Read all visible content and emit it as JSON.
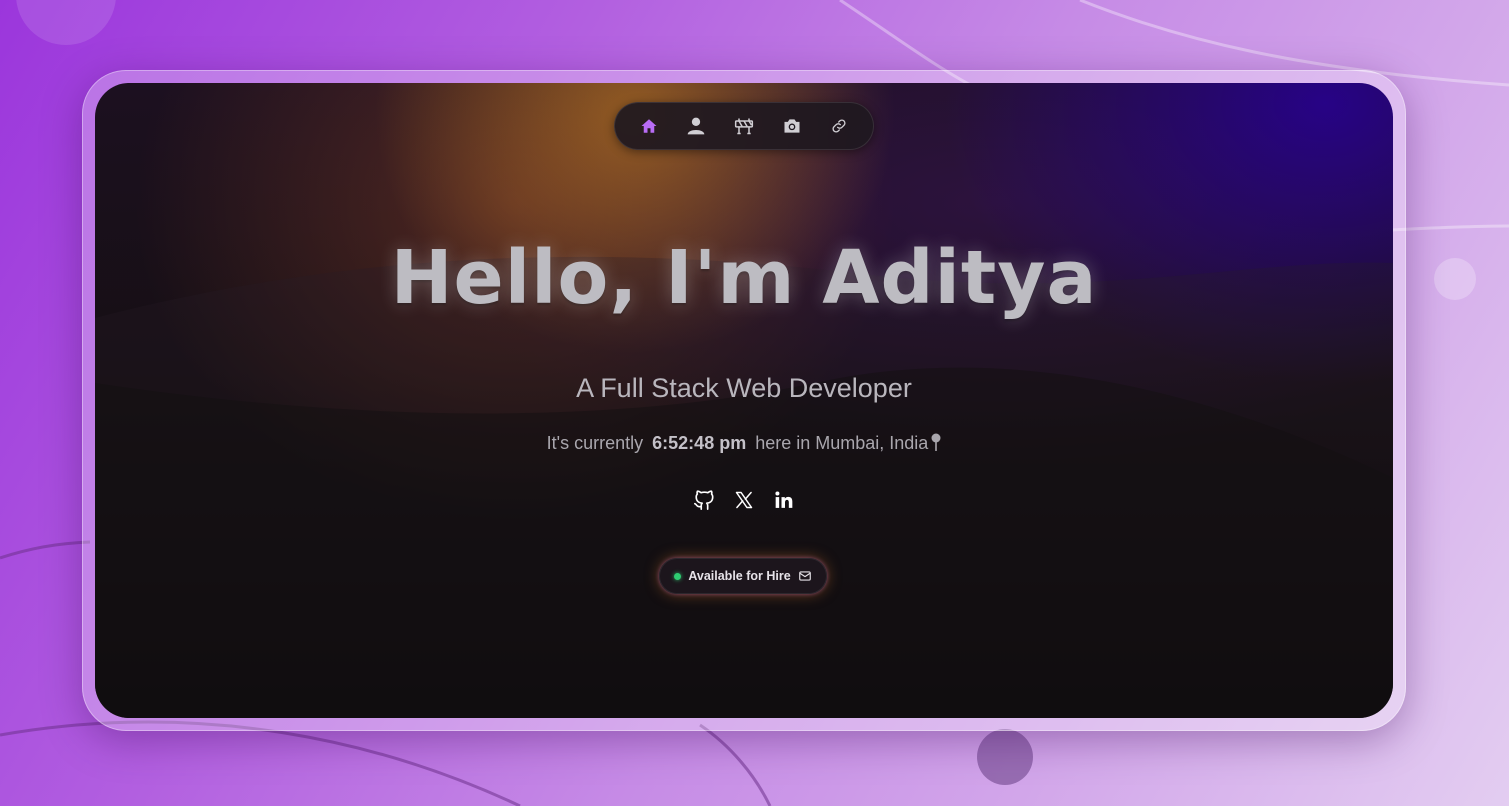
{
  "nav": {
    "items": [
      {
        "id": "home",
        "icon": "home-icon",
        "active": true
      },
      {
        "id": "about",
        "icon": "user-icon",
        "active": false
      },
      {
        "id": "projects",
        "icon": "roadblock-icon",
        "active": false
      },
      {
        "id": "gallery",
        "icon": "camera-icon",
        "active": false
      },
      {
        "id": "links",
        "icon": "link-icon",
        "active": false
      }
    ]
  },
  "hero": {
    "title": "Hello, I'm Aditya",
    "subtitle": "A Full Stack Web Developer",
    "time_prefix": "It's currently",
    "time": "6:52:48 pm",
    "time_suffix": "here in Mumbai, India"
  },
  "socials": [
    {
      "id": "github",
      "icon": "github-icon"
    },
    {
      "id": "x",
      "icon": "x-icon"
    },
    {
      "id": "linkedin",
      "icon": "linkedin-icon"
    }
  ],
  "hire_button": {
    "label": "Available for Hire",
    "status_color": "#2ecc71",
    "icon": "mail-icon"
  },
  "colors": {
    "accent": "#b86cf5",
    "icon": "#d0ced3",
    "title": "#bdbcc2"
  }
}
